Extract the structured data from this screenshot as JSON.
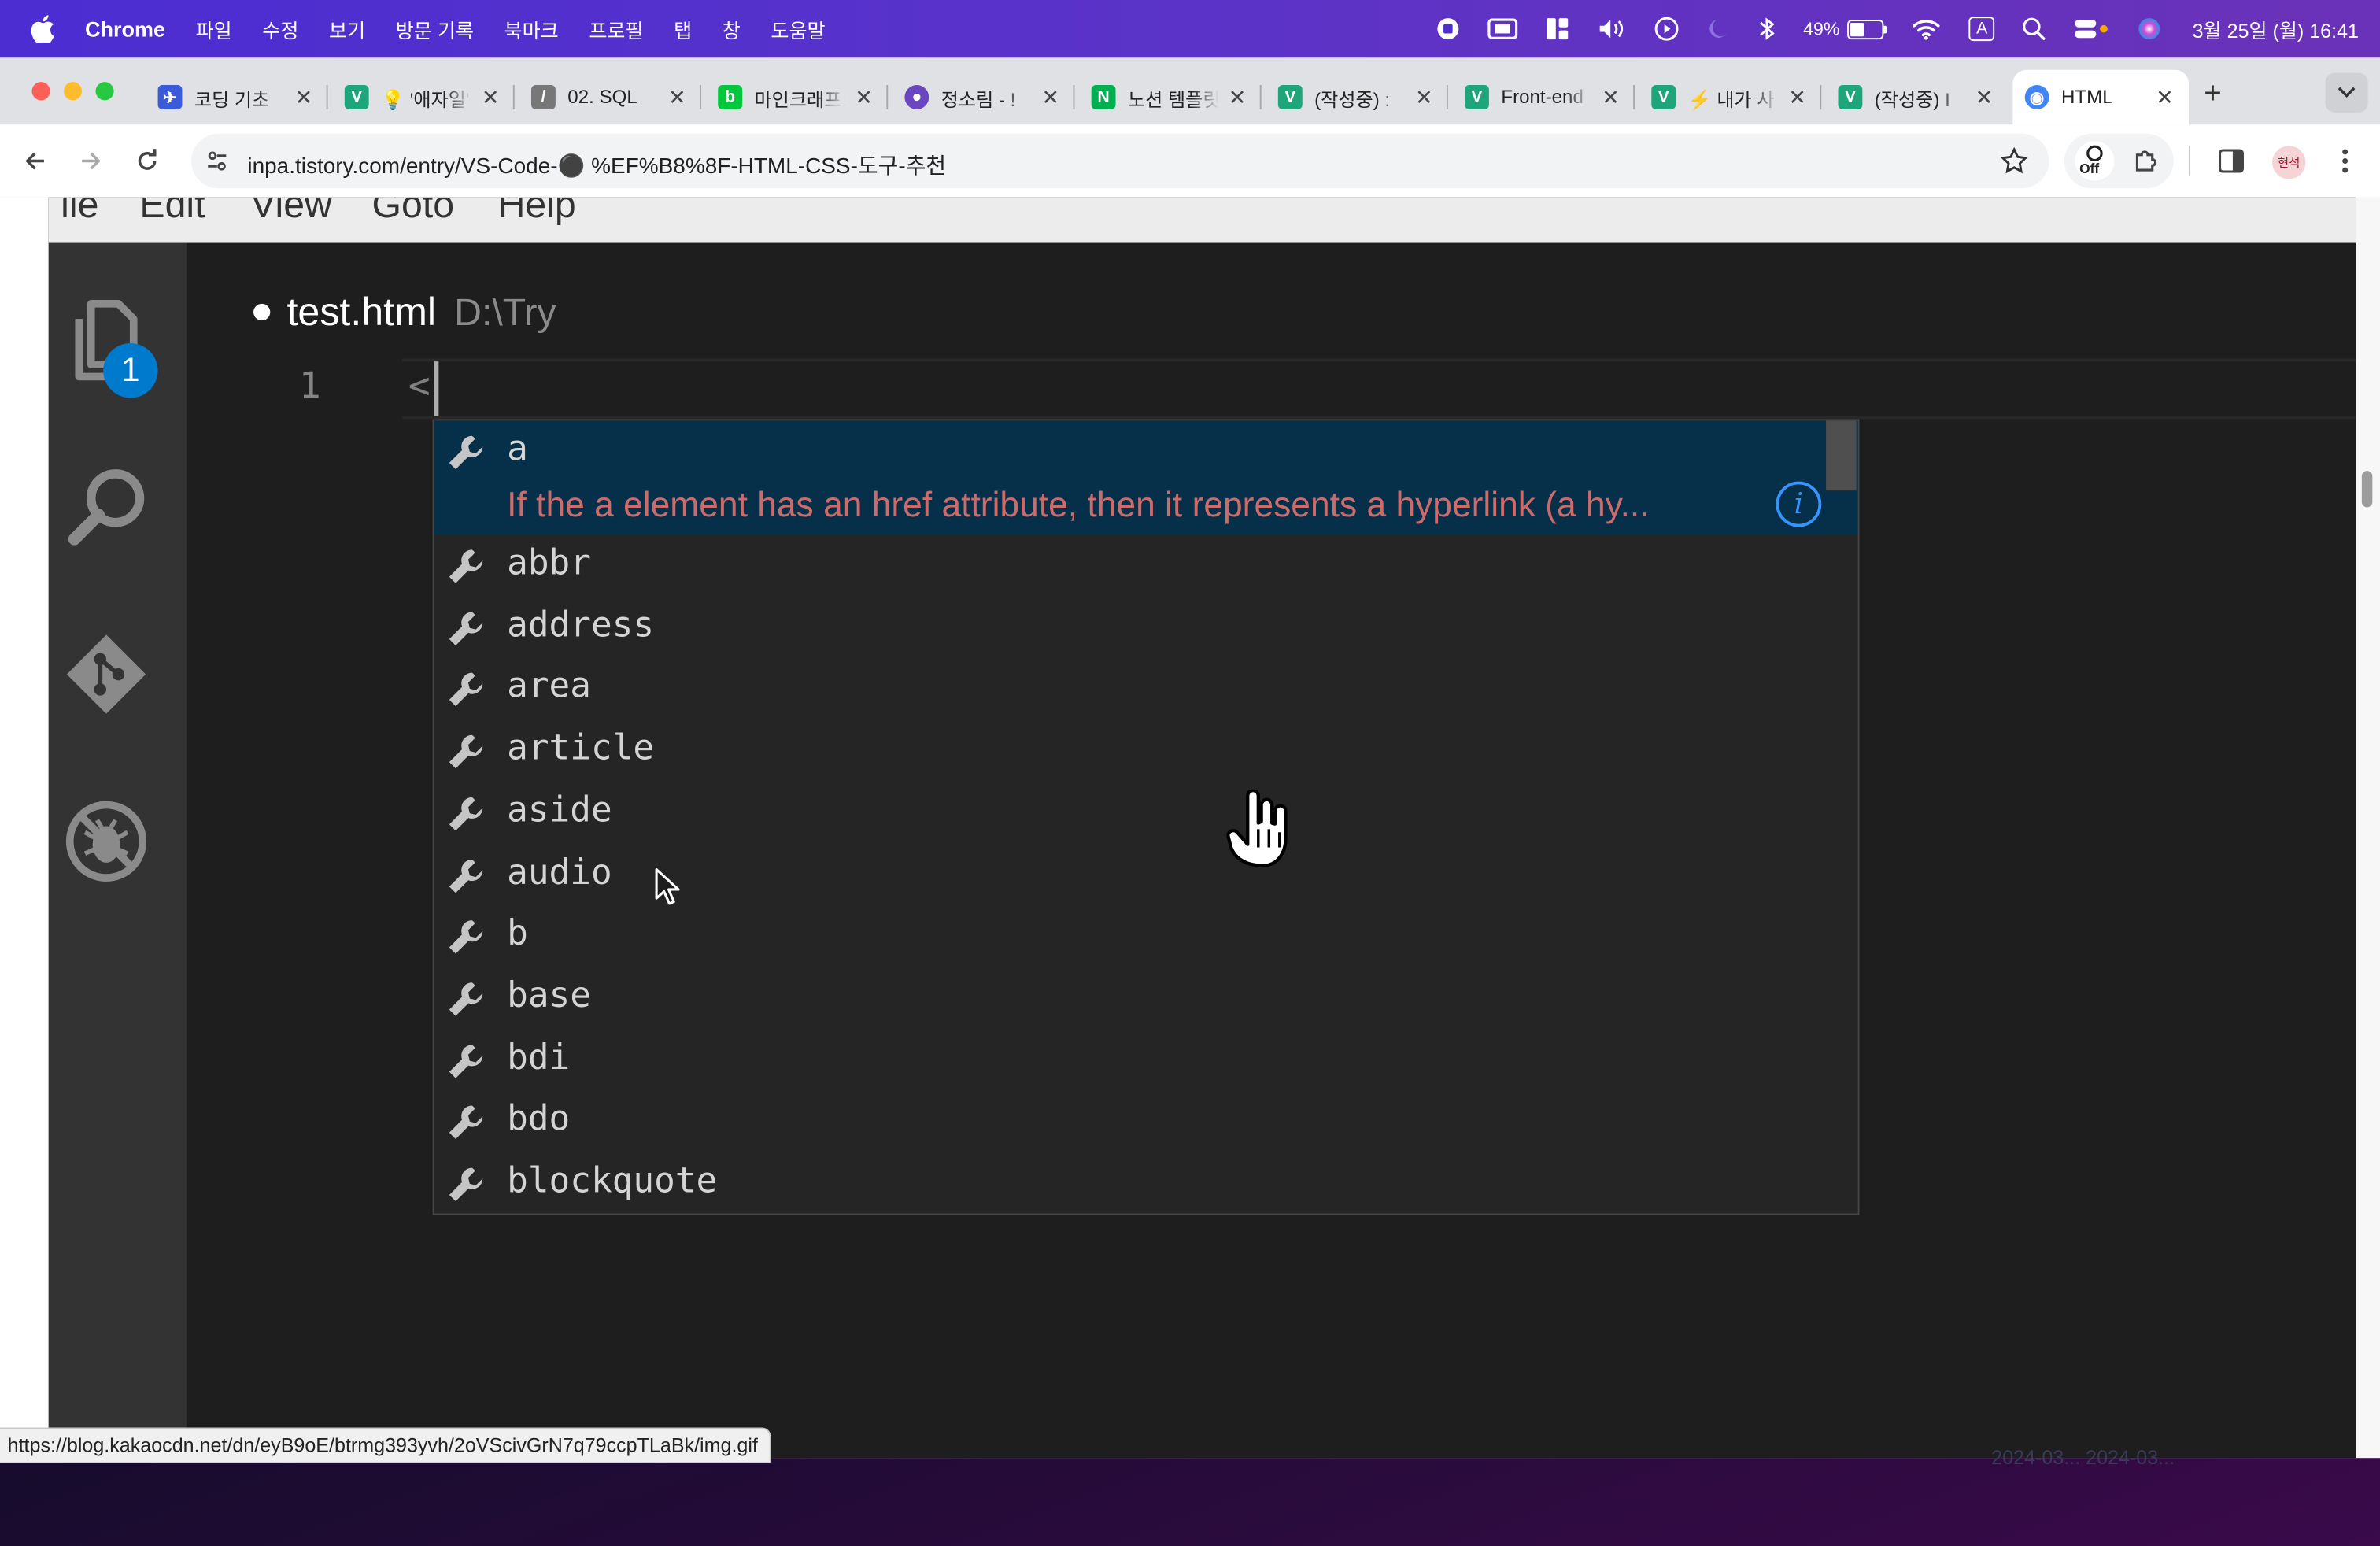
{
  "menubar": {
    "app_name": "Chrome",
    "items": [
      "파일",
      "수정",
      "보기",
      "방문 기록",
      "북마크",
      "프로필",
      "탭",
      "창",
      "도움말"
    ],
    "battery_percent": "49%",
    "battery_level": 0.49,
    "input_source": "A",
    "clock": "3월 25일 (월) 16:41"
  },
  "tabs": [
    {
      "title": "코딩 기초",
      "fav_color": "#3b5bdb",
      "fav_glyph": "✈"
    },
    {
      "title": "💡 '애자일'",
      "fav_color": "#1fa57a",
      "fav_glyph": "V"
    },
    {
      "title": "02. SQL",
      "fav_color": "#777777",
      "fav_glyph": "/"
    },
    {
      "title": "마인크래프트",
      "fav_color": "#00c73c",
      "fav_glyph": "b"
    },
    {
      "title": "정소림 - !",
      "fav_color": "#6b46c1",
      "fav_glyph": "●"
    },
    {
      "title": "노션 템플릿",
      "fav_color": "#00b050",
      "fav_glyph": "N"
    },
    {
      "title": "(작성중) :",
      "fav_color": "#1fa57a",
      "fav_glyph": "V"
    },
    {
      "title": "Front-end",
      "fav_color": "#1fa57a",
      "fav_glyph": "V"
    },
    {
      "title": "⚡ 내가 사",
      "fav_color": "#1fa57a",
      "fav_glyph": "V"
    },
    {
      "title": "(작성중) I",
      "fav_color": "#1fa57a",
      "fav_glyph": "V"
    },
    {
      "title": "HTML",
      "fav_color": "#4285f4",
      "fav_glyph": "◉"
    }
  ],
  "address_bar": {
    "url": "inpa.tistory.com/entry/VS-Code-⚫ %EF%B8%8F-HTML-CSS-도구-추천"
  },
  "extensions": {
    "off_label": "Off",
    "profile_label": "현석"
  },
  "vscode": {
    "menu": [
      "ile",
      "Edit",
      "View",
      "Goto",
      "Help"
    ],
    "explorer_badge": "1",
    "file_name": "test.html",
    "file_path": "D:\\Try",
    "line_number": "1",
    "typed_text": "<",
    "suggestions": [
      {
        "label": "a",
        "doc": "If the a element has an href attribute, then it represents a hyperlink (a hy..."
      },
      {
        "label": "abbr"
      },
      {
        "label": "address"
      },
      {
        "label": "area"
      },
      {
        "label": "article"
      },
      {
        "label": "aside"
      },
      {
        "label": "audio"
      },
      {
        "label": "b"
      },
      {
        "label": "base"
      },
      {
        "label": "bdi"
      },
      {
        "label": "bdo"
      },
      {
        "label": "blockquote"
      }
    ],
    "info_glyph": "i"
  },
  "status_link": "https://blog.kakaocdn.net/dn/eyB9oE/btrmg393yvh/2oVScivGrN7q79ccpTLaBk/img.gif",
  "background_ghost_text": "2024-03... 2024-03..."
}
